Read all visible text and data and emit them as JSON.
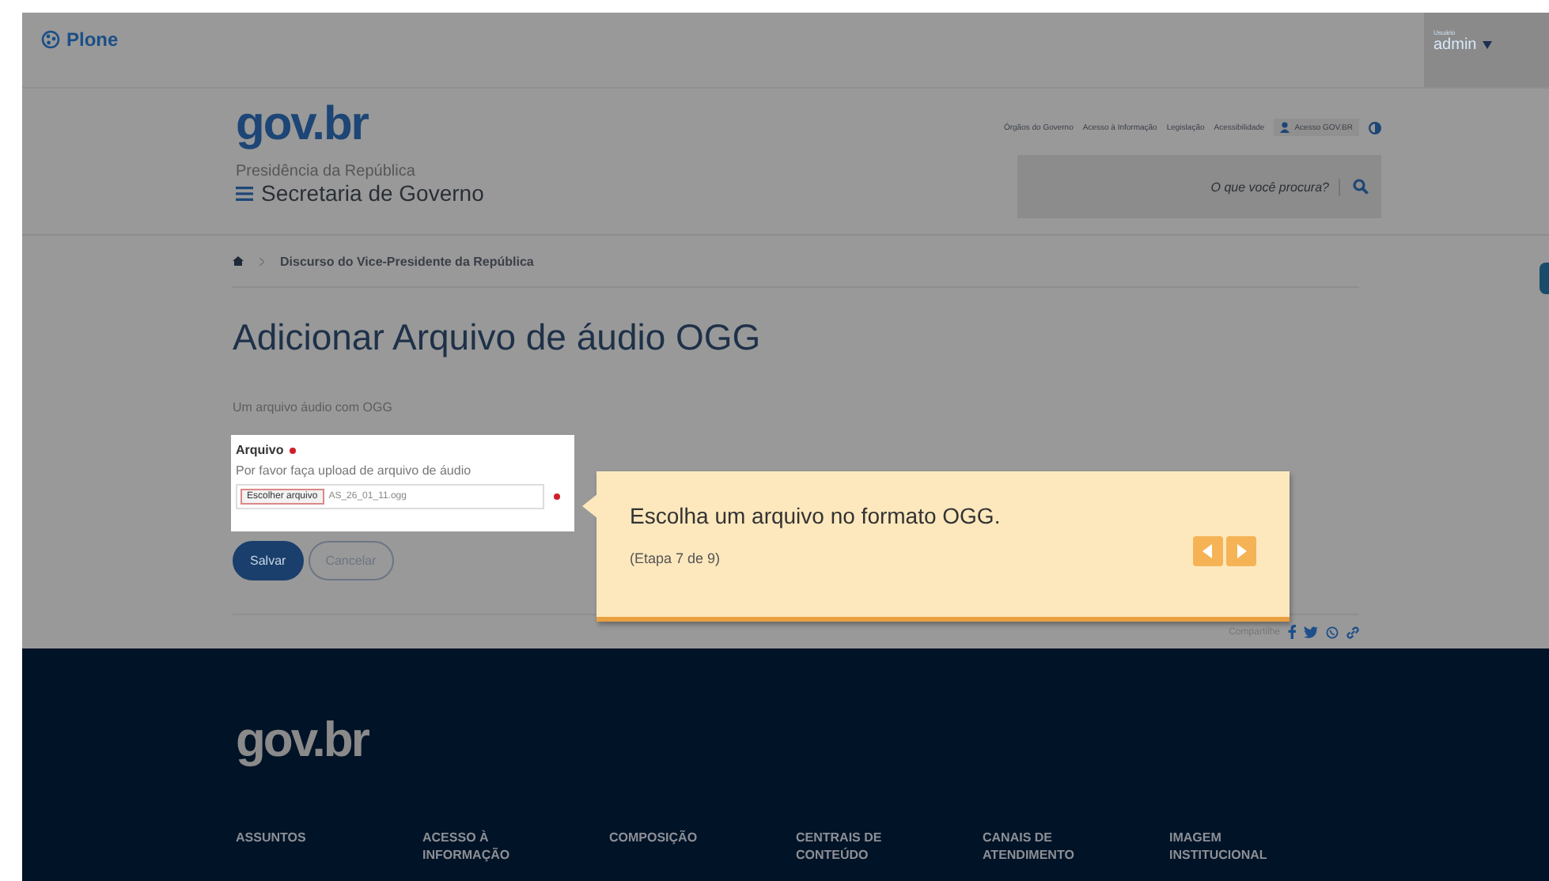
{
  "toolbar": {
    "logo": "Plone",
    "user_label": "Usuário",
    "user": "admin"
  },
  "header": {
    "logo": "gov.br",
    "org": "Presidência da República",
    "site": "Secretaria de Governo",
    "links": [
      "Órgãos do Governo",
      "Acesso à Informação",
      "Legislação",
      "Acessibilidade"
    ],
    "login": "Acesso GOV.BR",
    "search": {
      "placeholder": "O que você procura?"
    }
  },
  "breadcrumb": [
    "Discurso do Vice-Presidente da República"
  ],
  "title": "Adicionar Arquivo de áudio OGG",
  "description": "Um arquivo áudio com OGG",
  "field": {
    "label": "Arquivo",
    "required": true,
    "help": "Por favor faça upload de arquivo de áudio",
    "button": "Escolher arquivo",
    "file": "AS_26_01_11.ogg"
  },
  "buttons": [
    {
      "label": "Salvar",
      "kind": "primary"
    },
    {
      "label": "Cancelar",
      "kind": "secondary"
    }
  ],
  "share": {
    "label": "Compartilhe"
  },
  "tour": {
    "text": "Escolha um arquivo no formato OGG.",
    "step": "(Etapa 7 de 9)"
  },
  "footer": {
    "logo": "gov.br",
    "columns": [
      "ASSUNTOS",
      "ACESSO À INFORMAÇÃO",
      "COMPOSIÇÃO",
      "CENTRAIS DE CONTEÚDO",
      "CANAIS DE ATENDIMENTO",
      "IMAGEM INSTITUCIONAL"
    ]
  }
}
